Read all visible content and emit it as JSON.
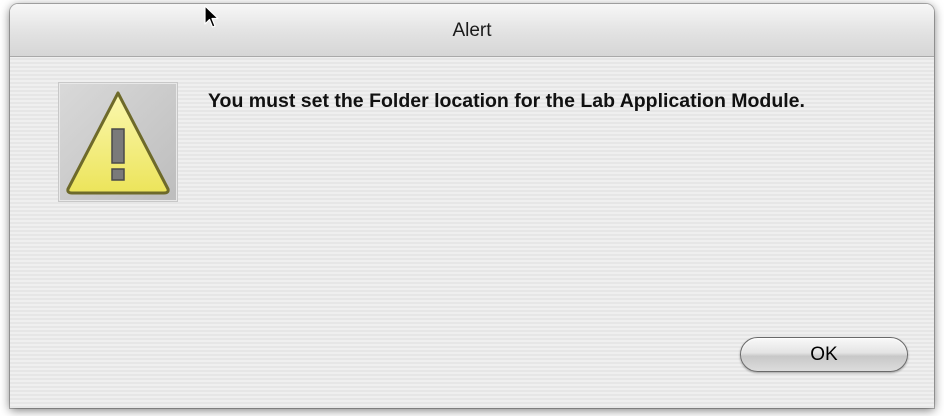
{
  "window": {
    "title": "Alert"
  },
  "alert": {
    "icon": "warning-triangle-icon",
    "message": "You must set the Folder location for the Lab Application Module."
  },
  "buttons": {
    "ok_label": "OK"
  },
  "colors": {
    "warning_fill": "#f3ee7a",
    "warning_outline": "#6e6a2a"
  }
}
